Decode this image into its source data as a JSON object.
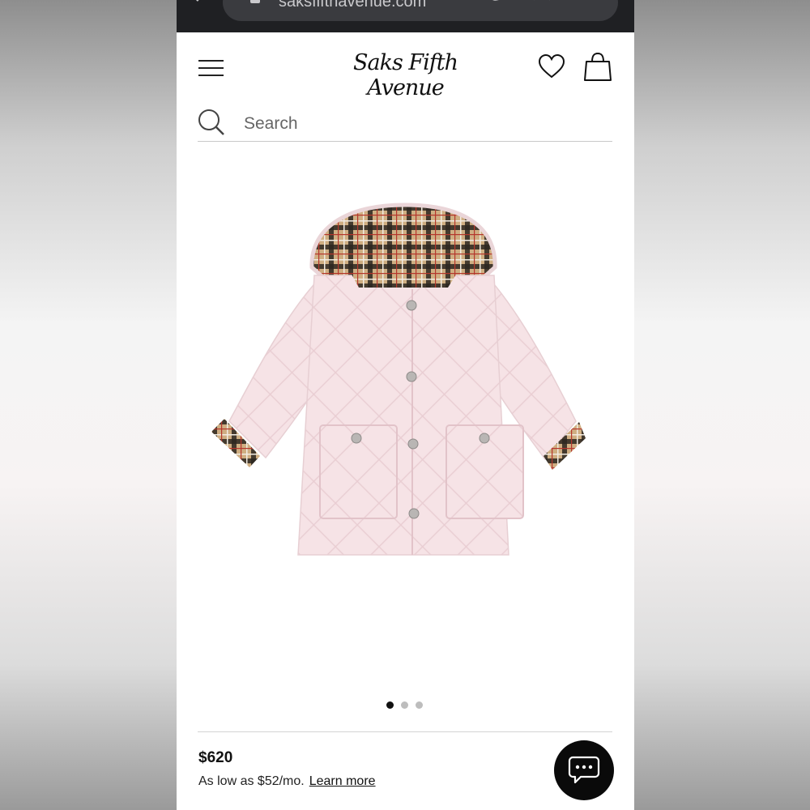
{
  "browser": {
    "url": "saksfifthavenue.com"
  },
  "header": {
    "logo_text": "Saks Fifth Avenue",
    "icons": [
      "menu-icon",
      "heart-icon",
      "shopping-bag-icon"
    ]
  },
  "search": {
    "placeholder": "Search"
  },
  "product": {
    "image_alt": "Pink quilted hooded coat with check lining",
    "carousel": {
      "total": 3,
      "active": 1
    },
    "price": "$620",
    "finance_text": "As low as $52/mo.",
    "learn_more": "Learn more"
  },
  "chat": {
    "icon": "chat-bubble-icon"
  },
  "colors": {
    "chrome_bg": "#1f2023",
    "coat_pink": "#f6e3e6",
    "check_tan": "#c9a77a",
    "chat_bg": "#0a0a0a"
  }
}
